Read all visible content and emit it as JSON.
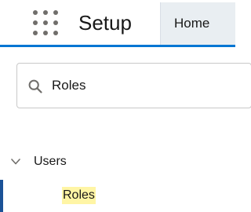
{
  "header": {
    "app_launcher_icon": "app-launcher-grid-icon",
    "title": "Setup",
    "tab_home": "Home",
    "accent_color": "#0176d3"
  },
  "quick_find": {
    "icon": "search-icon",
    "value": "Roles"
  },
  "tree": {
    "users": {
      "icon": "chevron-down-icon",
      "label": "Users",
      "expanded": true
    },
    "roles": {
      "label": "Roles",
      "selected": true,
      "highlight_color": "#fff5a5"
    }
  }
}
